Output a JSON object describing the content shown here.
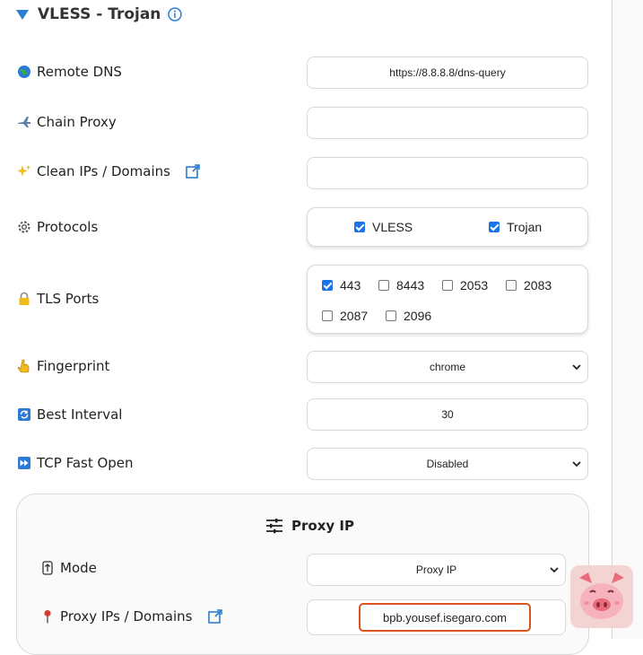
{
  "section": {
    "title": "VLESS - Trojan"
  },
  "rows": {
    "remote_dns": {
      "label": "Remote DNS",
      "value": "https://8.8.8.8/dns-query"
    },
    "chain_proxy": {
      "label": "Chain Proxy",
      "value": ""
    },
    "clean_ips": {
      "label": "Clean IPs / Domains",
      "value": ""
    },
    "protocols": {
      "label": "Protocols",
      "options": [
        {
          "label": "VLESS",
          "checked": true
        },
        {
          "label": "Trojan",
          "checked": true
        }
      ]
    },
    "tls_ports": {
      "label": "TLS Ports",
      "options": [
        {
          "label": "443",
          "checked": true
        },
        {
          "label": "8443",
          "checked": false
        },
        {
          "label": "2053",
          "checked": false
        },
        {
          "label": "2083",
          "checked": false
        },
        {
          "label": "2087",
          "checked": false
        },
        {
          "label": "2096",
          "checked": false
        }
      ]
    },
    "fingerprint": {
      "label": "Fingerprint",
      "value": "chrome"
    },
    "best_interval": {
      "label": "Best Interval",
      "value": "30"
    },
    "tcp_fast_open": {
      "label": "TCP Fast Open",
      "value": "Disabled"
    }
  },
  "proxy_ip": {
    "title": "Proxy IP",
    "mode": {
      "label": "Mode",
      "value": "Proxy IP"
    },
    "ips": {
      "label": "Proxy IPs / Domains",
      "value": "bpb.yousef.isegaro.com"
    }
  },
  "colors": {
    "accent": "#2a7fd0",
    "checkbox": "#1a73e8",
    "highlight": "#d9541e"
  }
}
